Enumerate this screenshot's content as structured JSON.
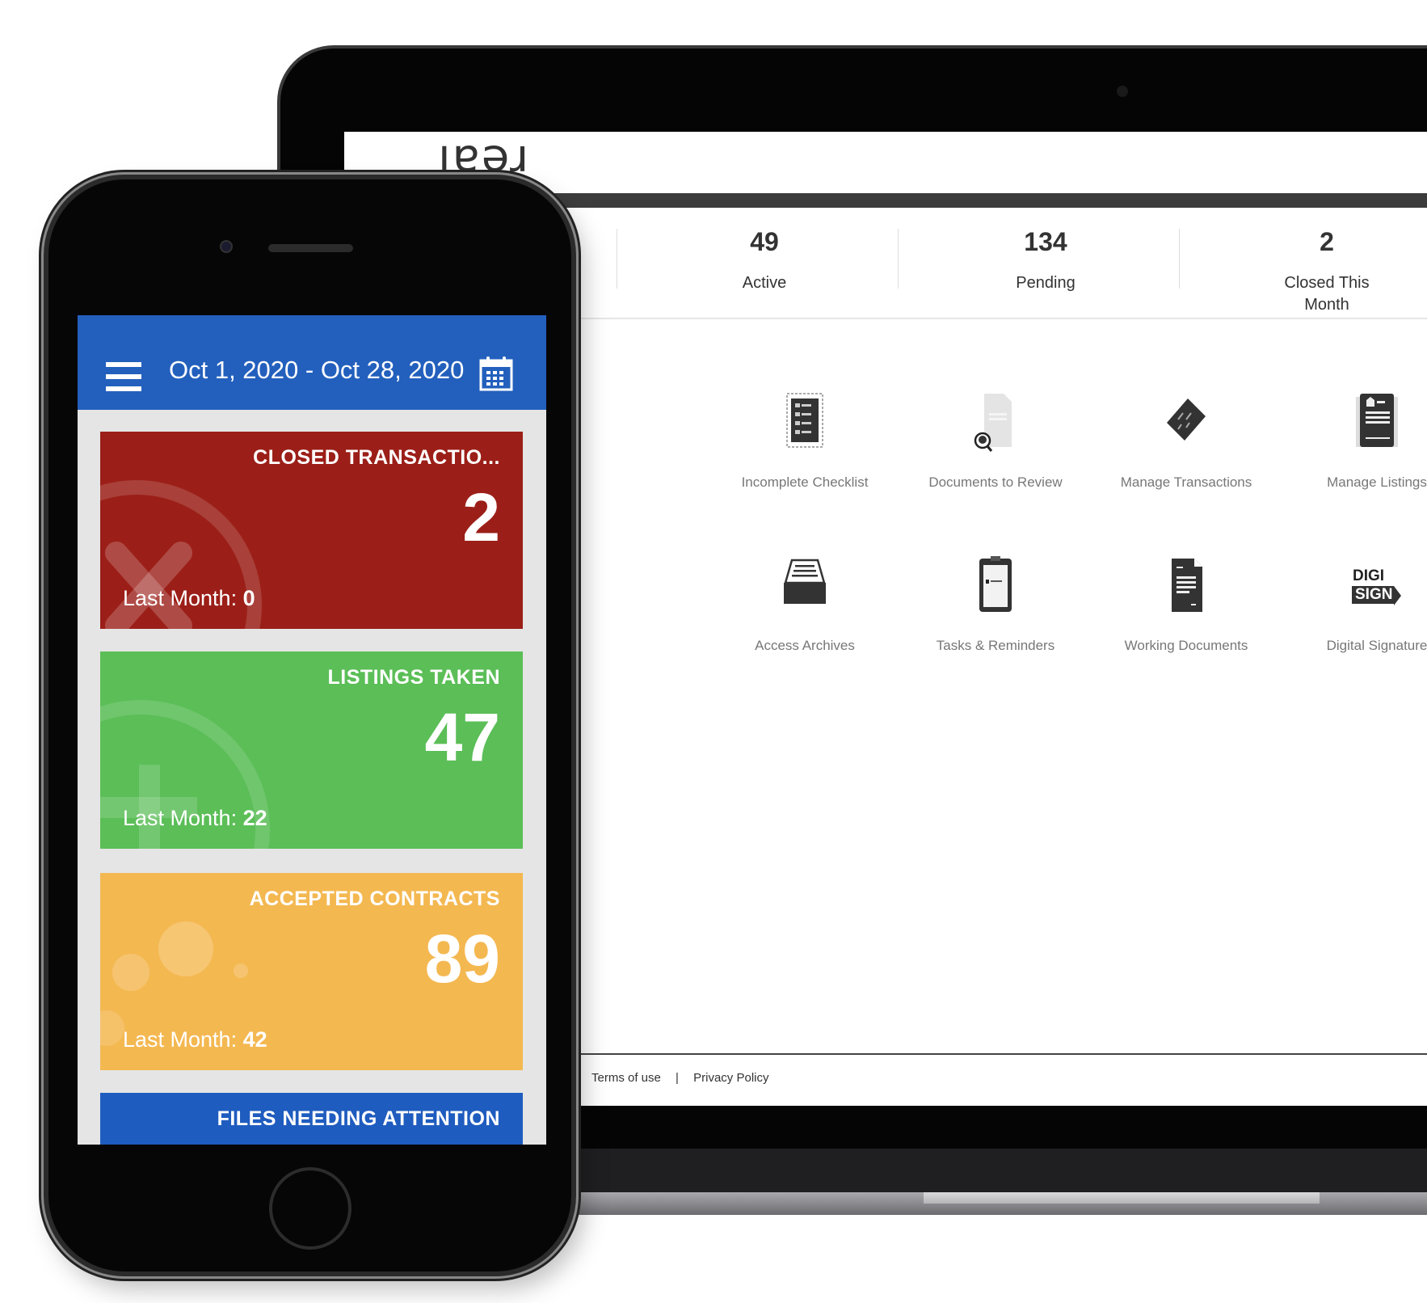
{
  "laptop": {
    "logo": "real",
    "stats": [
      {
        "value": "49",
        "label": "Active"
      },
      {
        "value": "134",
        "label": "Pending"
      },
      {
        "value": "2",
        "label": "Closed This Month"
      }
    ],
    "tiles": [
      {
        "label": "Incomplete Checklist",
        "icon": "checklist-icon"
      },
      {
        "label": "Documents to Review",
        "icon": "document-search-icon"
      },
      {
        "label": "Manage Transactions",
        "icon": "tag-icon"
      },
      {
        "label": "Manage Listings",
        "icon": "listing-icon"
      },
      {
        "label": "Access Archives",
        "icon": "archive-tray-icon"
      },
      {
        "label": "Tasks & Reminders",
        "icon": "clipboard-icon"
      },
      {
        "label": "Working Documents",
        "icon": "document-icon"
      },
      {
        "label": "Digital Signature",
        "icon": "digisign-icon"
      }
    ],
    "digisign": {
      "line1": "DIGI",
      "line2": "SIGN"
    },
    "footer": {
      "terms": "Terms of use",
      "separator": "|",
      "privacy": "Privacy Policy"
    }
  },
  "phone": {
    "date_range": "Oct 1, 2020 - Oct 28, 2020",
    "cards": [
      {
        "title": "CLOSED TRANSACTIO...",
        "value": "2",
        "last_month_label": "Last Month:",
        "last_month": "0",
        "color": "#9b1f18"
      },
      {
        "title": "LISTINGS TAKEN",
        "value": "47",
        "last_month_label": "Last Month:",
        "last_month": "22",
        "color": "#5bbe57"
      },
      {
        "title": "ACCEPTED CONTRACTS",
        "value": "89",
        "last_month_label": "Last Month:",
        "last_month": "42",
        "color": "#f4b851"
      },
      {
        "title": "FILES NEEDING ATTENTION",
        "color": "#1f5cbf"
      }
    ],
    "header_color": "#2360bd"
  }
}
